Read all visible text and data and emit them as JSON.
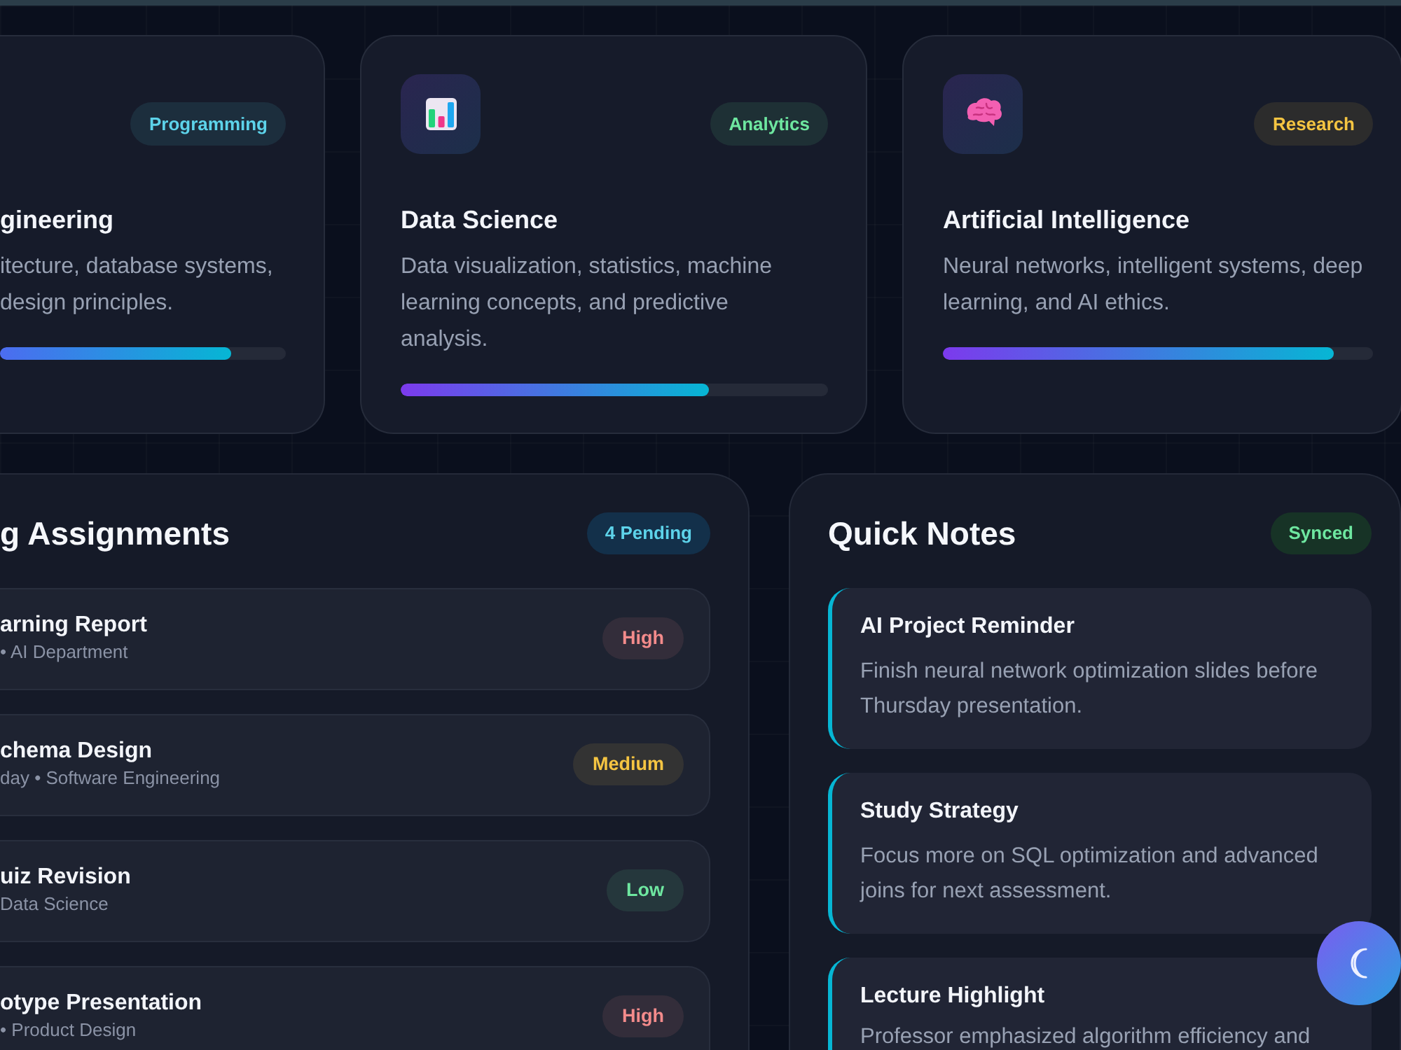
{
  "courses": [
    {
      "title": "gineering",
      "description": "itecture, database systems,\ndesign principles.",
      "tag": {
        "label": "Programming",
        "color": "#5dd3ea"
      },
      "level": 0.81
    },
    {
      "title": "Data Science",
      "description": "Data visualization, statistics, machine\nlearning concepts, and predictive\nanalysis.",
      "tag": {
        "label": "Analytics",
        "color": "#6ee7a0"
      },
      "level": 0.72
    },
    {
      "title": "Artificial Intelligence",
      "description": "Neural networks, intelligent systems, deep\nlearning, and AI ethics.",
      "tag": {
        "label": "Research",
        "color": "#f5c542"
      },
      "level": 0.91
    }
  ],
  "assignments": {
    "title": "g Assignments",
    "badge": "4 Pending",
    "items": [
      {
        "title": "arning Report",
        "meta": "• AI Department",
        "priority": {
          "label": "High",
          "color": "#f38b8b"
        }
      },
      {
        "title": "chema Design",
        "meta": "day • Software Engineering",
        "priority": {
          "label": "Medium",
          "color": "#f5c542"
        }
      },
      {
        "title": "uiz Revision",
        "meta": "Data Science",
        "priority": {
          "label": "Low",
          "color": "#6ee7a0"
        }
      },
      {
        "title": "otype Presentation",
        "meta": "• Product Design",
        "priority": {
          "label": "High",
          "color": "#f38b8b"
        }
      }
    ]
  },
  "notes": {
    "title": "Quick Notes",
    "badge": "Synced",
    "items": [
      {
        "title": "AI Project Reminder",
        "body": "Finish neural network optimization slides before\nThursday presentation."
      },
      {
        "title": "Study Strategy",
        "body": "Focus more on SQL optimization and advanced\njoins for next assessment."
      },
      {
        "title": "Lecture Highlight",
        "body": "Professor emphasized algorithm efficiency and"
      }
    ]
  }
}
